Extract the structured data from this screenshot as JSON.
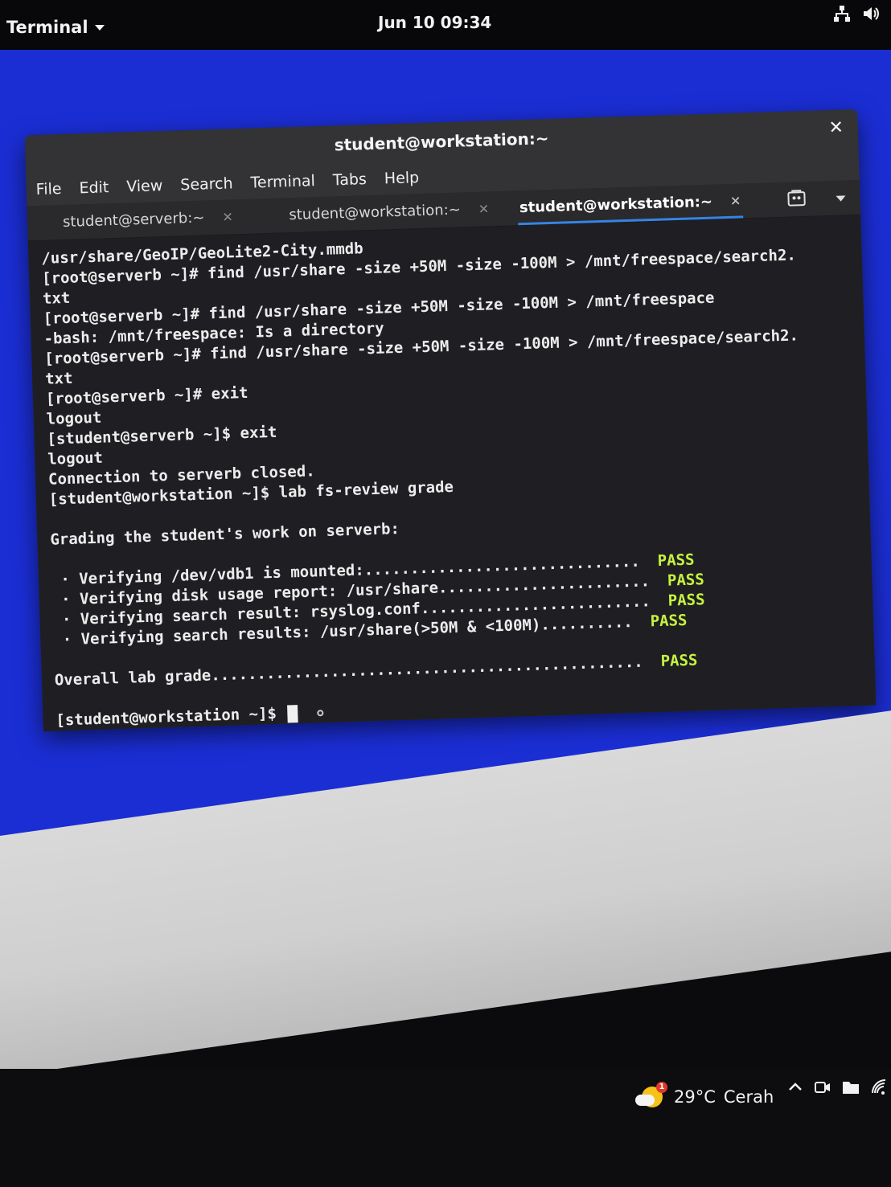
{
  "topbar": {
    "app_menu_label": "Terminal",
    "clock": "Jun 10  09:34",
    "icons": [
      "network-icon",
      "volume-icon"
    ]
  },
  "window": {
    "title": "student@workstation:~",
    "menu": [
      "File",
      "Edit",
      "View",
      "Search",
      "Terminal",
      "Tabs",
      "Help"
    ],
    "tabs": [
      {
        "label": "student@serverb:~",
        "active": false
      },
      {
        "label": "student@workstation:~",
        "active": false
      },
      {
        "label": "student@workstation:~",
        "active": true
      }
    ]
  },
  "terminal": {
    "lines": [
      "/usr/share/GeoIP/GeoLite2-City.mmdb",
      "[root@serverb ~]# find /usr/share -size +50M -size -100M > /mnt/freespace/search2.",
      "txt",
      "[root@serverb ~]# find /usr/share -size +50M -size -100M > /mnt/freespace",
      "-bash: /mnt/freespace: Is a directory",
      "[root@serverb ~]# find /usr/share -size +50M -size -100M > /mnt/freespace/search2.",
      "txt",
      "[root@serverb ~]# exit",
      "logout",
      "[student@serverb ~]$ exit",
      "logout",
      "Connection to serverb closed.",
      "[student@workstation ~]$ lab fs-review grade",
      "",
      "Grading the student's work on serverb:",
      ""
    ],
    "grade_checks": [
      {
        "text": " · Verifying /dev/vdb1 is mounted:..............................",
        "result": "PASS"
      },
      {
        "text": " · Verifying disk usage report: /usr/share.......................",
        "result": "PASS"
      },
      {
        "text": " · Verifying search result: rsyslog.conf.........................",
        "result": "PASS"
      },
      {
        "text": " · Verifying search results: /usr/share(>50M & <100M)..........",
        "result": "PASS"
      }
    ],
    "overall": {
      "text": "Overall lab grade...............................................",
      "result": "PASS"
    },
    "prompt": "[student@workstation ~]$ "
  },
  "taskbar": {
    "temperature": "29°C",
    "condition": "Cerah",
    "weather_badge": "1"
  }
}
